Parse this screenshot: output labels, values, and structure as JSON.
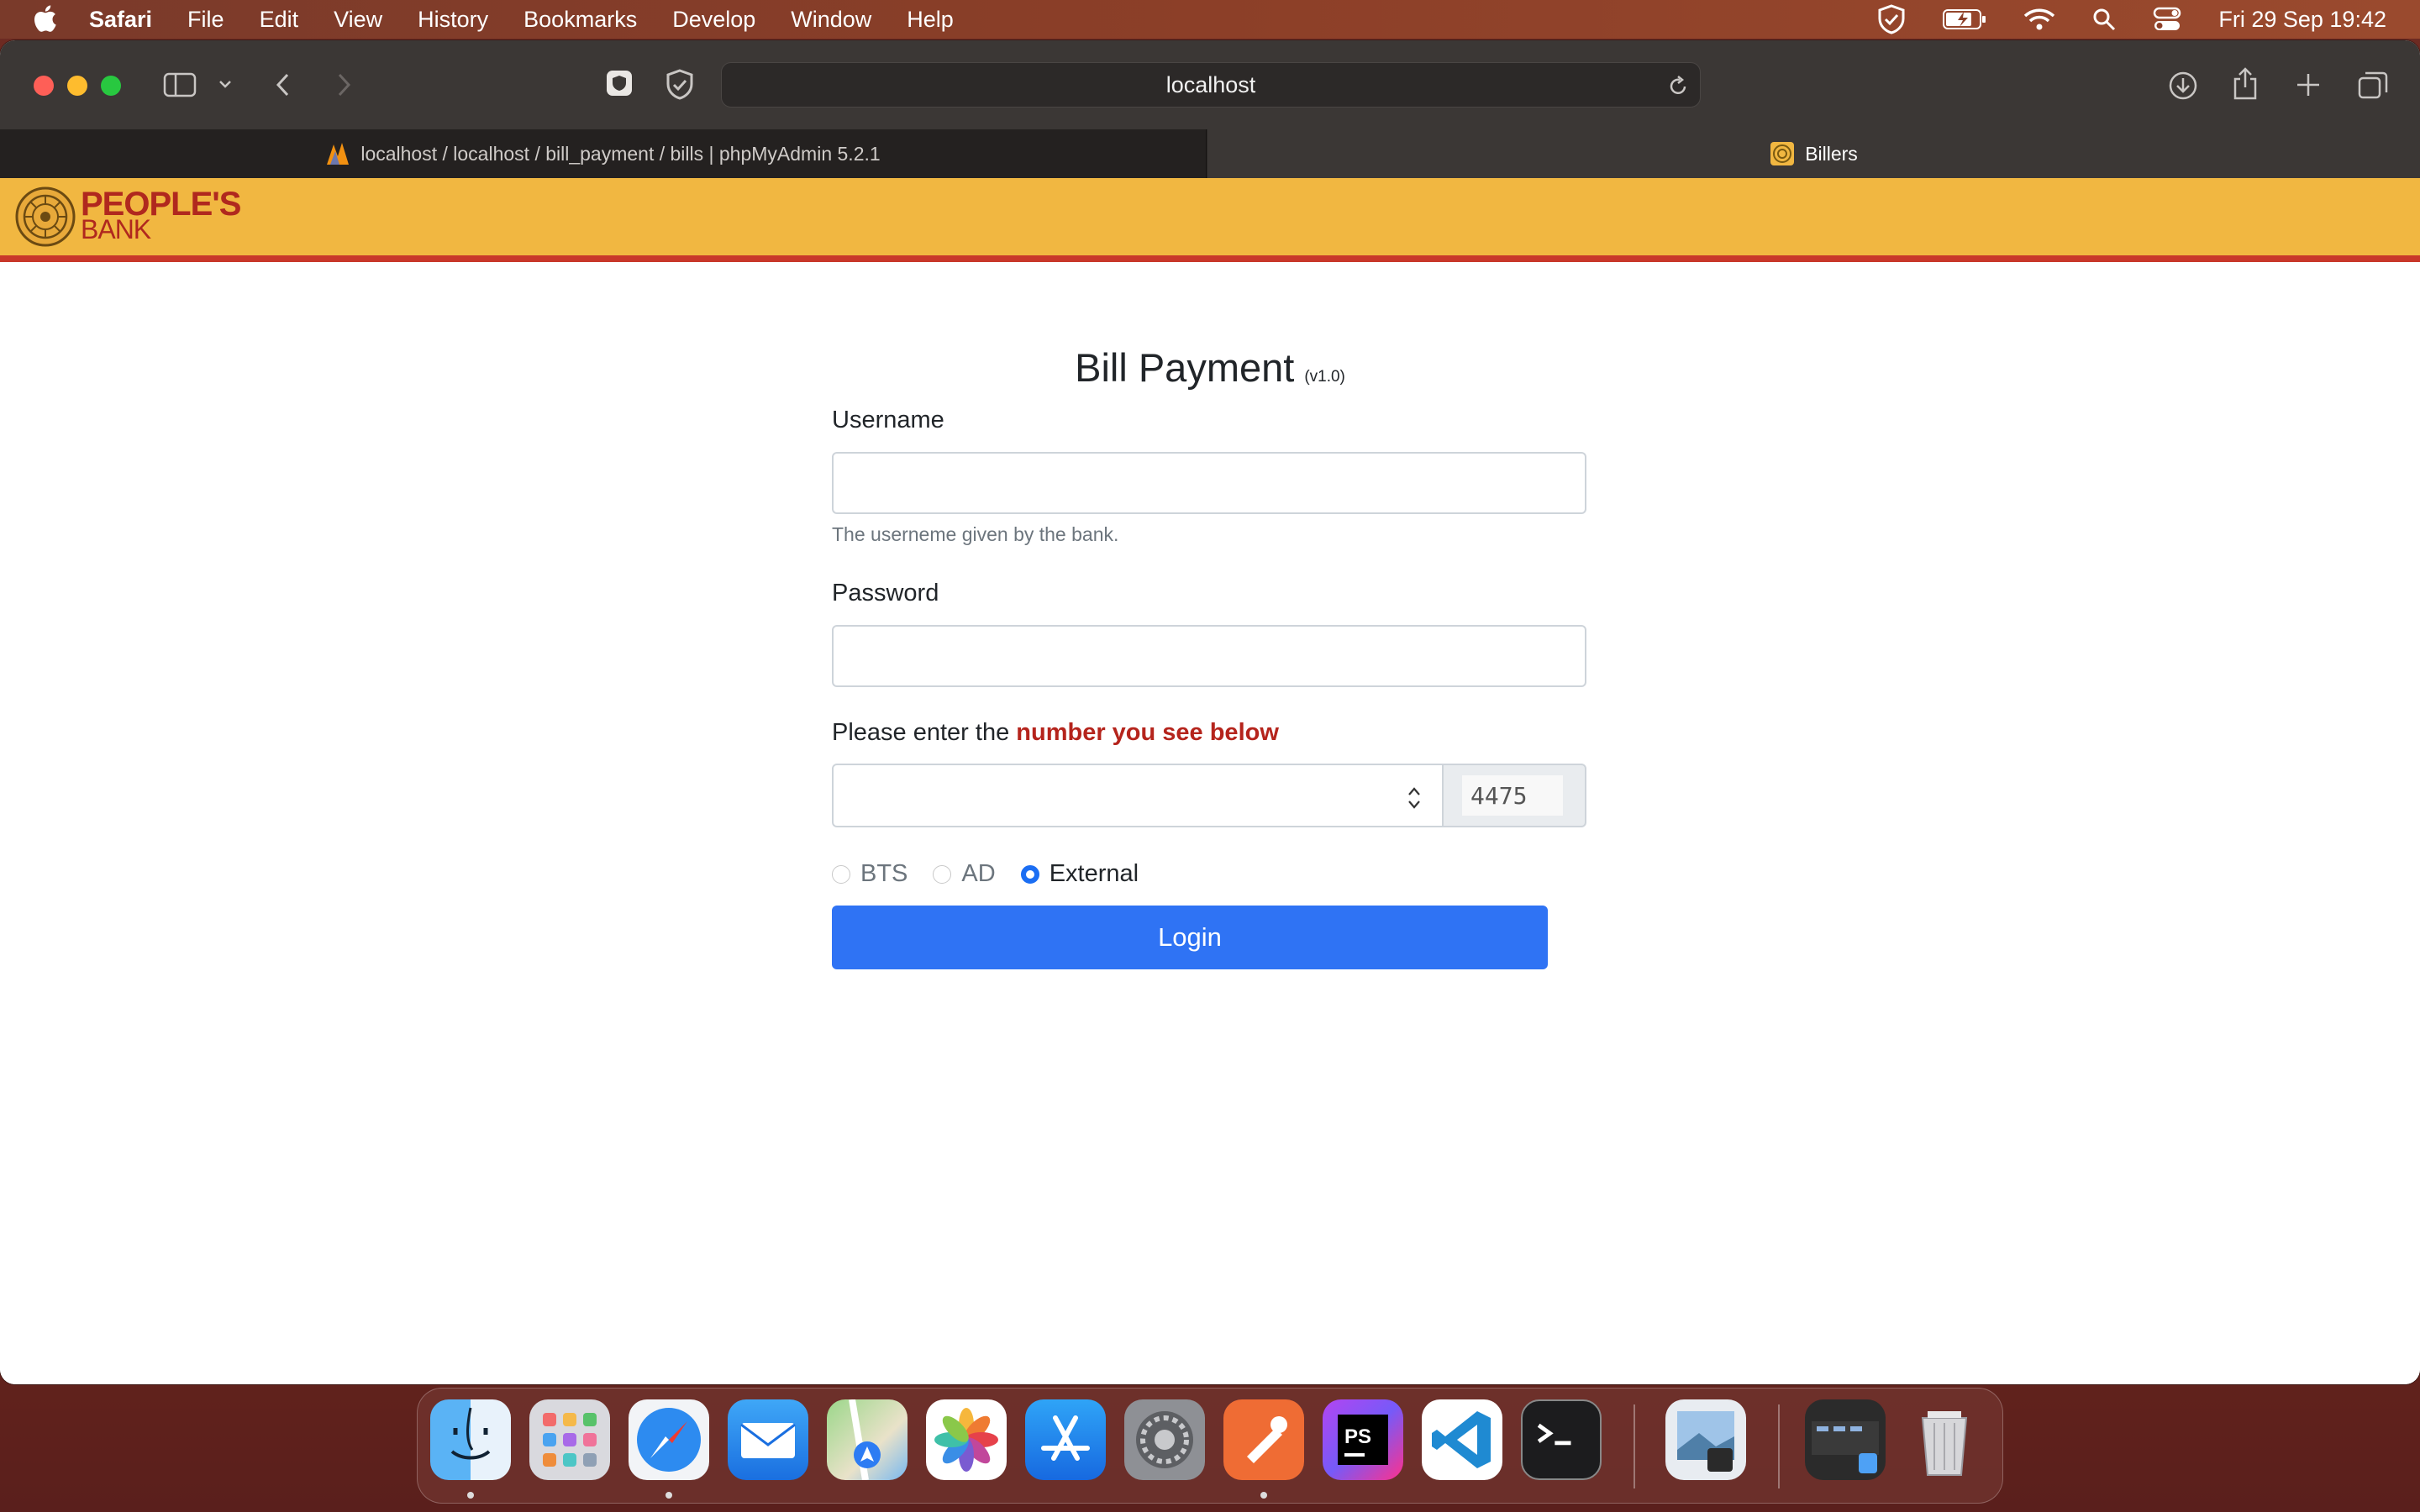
{
  "menubar": {
    "app": "Safari",
    "items": [
      "File",
      "Edit",
      "View",
      "History",
      "Bookmarks",
      "Develop",
      "Window",
      "Help"
    ],
    "clock": "Fri 29 Sep  19:42"
  },
  "browser": {
    "url": "localhost",
    "tabs": [
      {
        "title": "localhost / localhost / bill_payment / bills | phpMyAdmin 5.2.1",
        "active": false
      },
      {
        "title": "Billers",
        "active": true
      }
    ]
  },
  "header": {
    "logo_line1": "PEOPLE'S",
    "logo_line2": "BANK",
    "bar_color": "#f1b741",
    "stripe_color": "#c8372a"
  },
  "form": {
    "title": "Bill Payment",
    "version": "(v1.0)",
    "username_label": "Username",
    "username_value": "",
    "username_help": "The userneme given by the bank.",
    "password_label": "Password",
    "password_value": "",
    "captcha_label_prefix": "Please enter the ",
    "captcha_label_emphasis": "number you see below",
    "captcha_value": "",
    "captcha_number": "4475",
    "radio_options": [
      {
        "label": "BTS",
        "checked": false
      },
      {
        "label": "AD",
        "checked": false
      },
      {
        "label": "External",
        "checked": true
      }
    ],
    "login_label": "Login",
    "accent_color": "#2f73f4"
  },
  "dock": {
    "apps": [
      "finder-icon",
      "launchpad-icon",
      "safari-icon",
      "mail-icon",
      "maps-icon",
      "photos-icon",
      "app-store-icon",
      "system-settings-icon",
      "postman-icon",
      "phpstorm-icon",
      "vscode-icon",
      "terminal-icon",
      "preview-icon",
      "screenshot-folder-icon",
      "trash-icon"
    ]
  }
}
